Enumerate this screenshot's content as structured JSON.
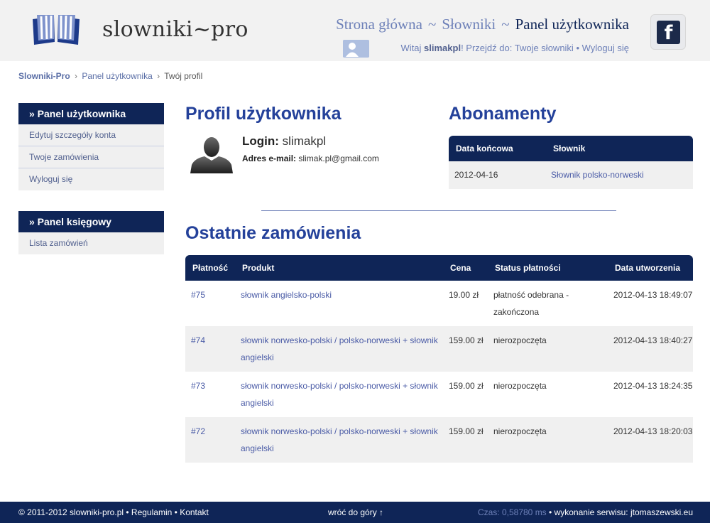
{
  "header": {
    "logo_text": "slowniki~pro",
    "nav": {
      "home": "Strona główna",
      "separator": "~",
      "dictionaries": "Słowniki",
      "current": "Panel użytkownika"
    },
    "welcome": {
      "greeting": "Witaj",
      "username": "slimakpl",
      "goto_text": "! Przejdź do:",
      "my_dictionaries": "Twoje słowniki",
      "bullet": "•",
      "logout": "Wyloguj się"
    },
    "facebook_letter": "f"
  },
  "breadcrumb": {
    "home": "Slowniki-Pro",
    "sep": "›",
    "panel": "Panel użytkownika",
    "current": "Twój profil"
  },
  "sidebar": {
    "user_panel": {
      "title": "» Panel użytkownika",
      "items": [
        "Edytuj szczegóły konta",
        "Twoje zamówienia",
        "Wyloguj się"
      ]
    },
    "accounting_panel": {
      "title": "» Panel księgowy",
      "items": [
        "Lista zamówień"
      ]
    }
  },
  "profile": {
    "heading": "Profil użytkownika",
    "login_label": "Login:",
    "login_value": "slimakpl",
    "email_label": "Adres e-mail:",
    "email_value": "slimak.pl@gmail.com"
  },
  "subscriptions": {
    "heading": "Abonamenty",
    "columns": [
      "Data końcowa",
      "Słownik"
    ],
    "rows": [
      {
        "date": "2012-04-16",
        "dictionary": "Słownik polsko-norweski"
      }
    ]
  },
  "orders": {
    "heading": "Ostatnie zamówienia",
    "columns": [
      "Płatność",
      "Produkt",
      "Cena",
      "Status płatności",
      "Data utworzenia"
    ],
    "rows": [
      {
        "payment": "#75",
        "product": "słownik angielsko-polski",
        "price": "19.00 zł",
        "status": "płatność odebrana - zakończona",
        "created": "2012-04-13 18:49:07"
      },
      {
        "payment": "#74",
        "product": "słownik norwesko-polski / polsko-norweski + słownik angielski",
        "price": "159.00 zł",
        "status": "nierozpoczęta",
        "created": "2012-04-13 18:40:27"
      },
      {
        "payment": "#73",
        "product": "słownik norwesko-polski / polsko-norweski + słownik angielski",
        "price": "159.00 zł",
        "status": "nierozpoczęta",
        "created": "2012-04-13 18:24:35"
      },
      {
        "payment": "#72",
        "product": "słownik norwesko-polski / polsko-norweski + słownik angielski",
        "price": "159.00 zł",
        "status": "nierozpoczęta",
        "created": "2012-04-13 18:20:03"
      }
    ]
  },
  "footer": {
    "copyright": "© 2011-2012 slowniki-pro.pl",
    "bullet": "•",
    "terms": "Regulamin",
    "contact": "Kontakt",
    "back_to_top": "wróć do góry ↑",
    "time": "Czas: 0,58780 ms",
    "credit": "wykonanie serwisu: jtomaszewski.eu"
  },
  "colors": {
    "navy": "#0f2557",
    "heading_blue": "#24419a",
    "link_blue": "#4a5ba6",
    "light_row": "#f0f0f0"
  }
}
